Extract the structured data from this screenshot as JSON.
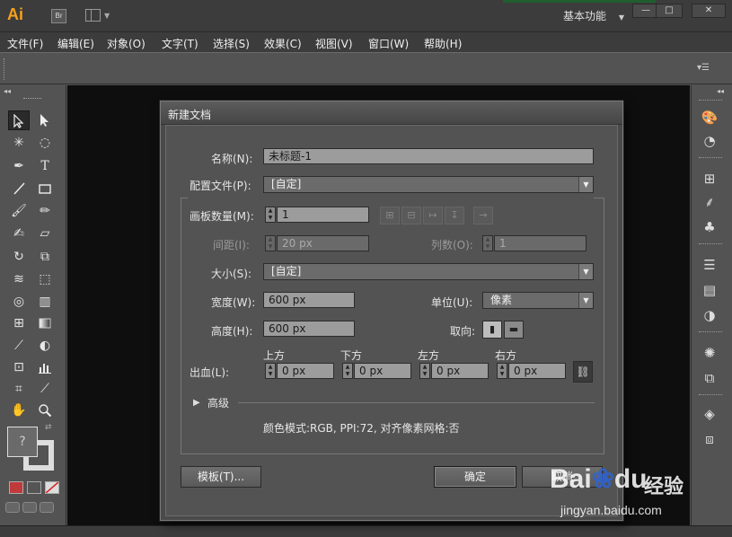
{
  "app": {
    "logo_text": "Ai",
    "bridge_label": "Br",
    "workspace": "基本功能",
    "window_controls": {
      "minimize": "—",
      "maximize": "□",
      "close": "✕"
    }
  },
  "menubar": {
    "items": [
      "文件(F)",
      "编辑(E)",
      "对象(O)",
      "文字(T)",
      "选择(S)",
      "效果(C)",
      "视图(V)",
      "窗口(W)",
      "帮助(H)"
    ]
  },
  "toolbar": {
    "tools": [
      "selection-tool",
      "direct-selection-tool",
      "magic-wand-tool",
      "lasso-tool",
      "pen-tool",
      "type-tool",
      "line-segment-tool",
      "rectangle-tool",
      "paintbrush-tool",
      "pencil-tool",
      "blob-brush-tool",
      "eraser-tool",
      "rotate-tool",
      "scale-tool",
      "width-tool",
      "free-transform-tool",
      "shape-builder-tool",
      "perspective-grid-tool",
      "mesh-tool",
      "gradient-tool",
      "eyedropper-tool",
      "blend-tool",
      "symbol-sprayer-tool",
      "column-graph-tool",
      "artboard-tool",
      "slice-tool",
      "hand-tool",
      "zoom-tool"
    ],
    "fill_unknown_symbol": "?"
  },
  "dock": {
    "icons": [
      "color-icon",
      "color-guide-icon",
      "swatches-icon",
      "brushes-icon",
      "symbols-icon",
      "stroke-icon",
      "gradient-icon",
      "transparency-icon",
      "appearance-icon",
      "graphic-styles-icon",
      "layers-icon",
      "artboards-icon"
    ]
  },
  "dialog": {
    "title": "新建文档",
    "name_label": "名称(N):",
    "name_value": "未标题-1",
    "profile_label": "配置文件(P):",
    "profile_value": "[自定]",
    "artboards_label": "画板数量(M):",
    "artboards_value": "1",
    "spacing_label": "间距(I):",
    "spacing_value": "20 px",
    "columns_label": "列数(O):",
    "columns_value": "1",
    "size_label": "大小(S):",
    "size_value": "[自定]",
    "width_label": "宽度(W):",
    "width_value": "600 px",
    "units_label": "单位(U):",
    "units_value": "像素",
    "height_label": "高度(H):",
    "height_value": "600 px",
    "orientation_label": "取向:",
    "bleed_label": "出血(L):",
    "bleed_top_label": "上方",
    "bleed_bottom_label": "下方",
    "bleed_left_label": "左方",
    "bleed_right_label": "右方",
    "bleed_top": "0 px",
    "bleed_bottom": "0 px",
    "bleed_left": "0 px",
    "bleed_right": "0 px",
    "advanced_label": "高级",
    "summary": "颜色模式:RGB, PPI:72, 对齐像素网格:否",
    "templates_button": "模板(T)...",
    "ok_button": "确定",
    "cancel_button": "取消"
  },
  "watermark": {
    "brand": "Bai",
    "brand_suffix": "du",
    "cn": "经验",
    "url": "jingyan.baidu.com"
  },
  "colors": {
    "ui_bg": "#535353",
    "canvas": "#0e0e0e",
    "logo": "#f7a21b",
    "watermark_paw": "#2e64d6"
  }
}
